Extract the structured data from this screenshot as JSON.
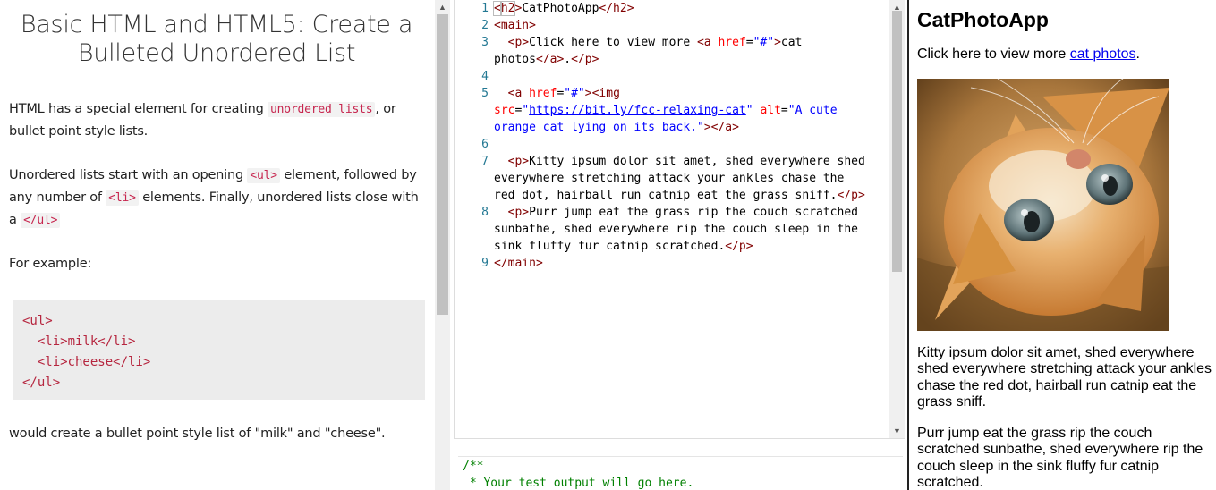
{
  "instructions": {
    "title": "Basic HTML and HTML5: Create a Bulleted Unordered List",
    "p1_pre": "HTML has a special element for creating ",
    "p1_code": "unordered lists",
    "p1_post": ", or bullet point style lists.",
    "p2_pre": "Unordered lists start with an opening ",
    "p2_code1": "<ul>",
    "p2_mid": " element, followed by any number of ",
    "p2_code2": "<li>",
    "p2_mid2": " elements. Finally, unordered lists close with a ",
    "p2_code3": "</ul>",
    "p3": "For example:",
    "example_lines": [
      "<ul>",
      "  <li>milk</li>",
      "  <li>cheese</li>",
      "</ul>"
    ],
    "p4": "would create a bullet point style list of \"milk\" and \"cheese\"."
  },
  "editor": {
    "line_numbers": [
      "1",
      "2",
      "3",
      "4",
      "5",
      "6",
      "7",
      "8",
      "9"
    ]
  },
  "test_output": {
    "lines": [
      "/**",
      " * Your test output will go here."
    ]
  },
  "preview": {
    "heading": "CatPhotoApp",
    "p1_pre": "Click here to view more ",
    "p1_link": "cat photos",
    "p1_post": ".",
    "img_alt": "A cute orange cat lying on its back.",
    "p2": "Kitty ipsum dolor sit amet, shed everywhere shed everywhere stretching attack your ankles chase the red dot, hairball run catnip eat the grass sniff.",
    "p3": "Purr jump eat the grass rip the couch scratched sunbathe, shed everywhere rip the couch sleep in the sink fluffy fur catnip scratched."
  },
  "colors": {
    "code_tag": "#800000",
    "code_attr": "#ff0000",
    "code_string": "#0000ff",
    "inline_code": "#c7254e",
    "test_output": "#008000",
    "preview_link": "#0000ee"
  }
}
